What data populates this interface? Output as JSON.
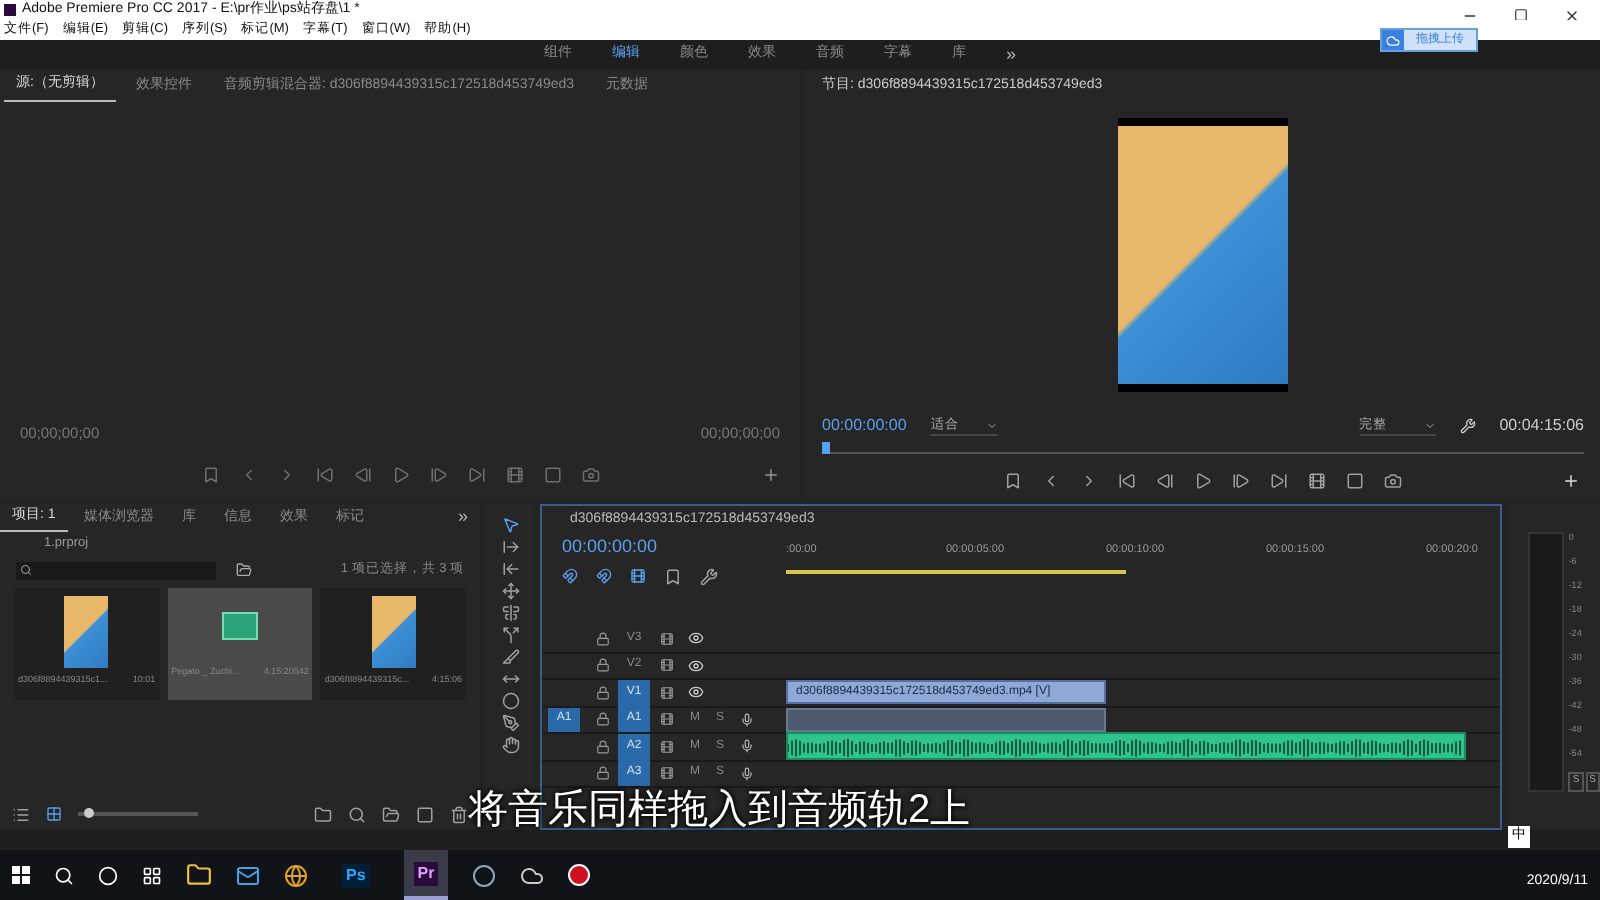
{
  "window": {
    "title": "Adobe Premiere Pro CC 2017 - E:\\pr作业\\ps站存盘\\1 *"
  },
  "menu": [
    "文件(F)",
    "编辑(E)",
    "剪辑(C)",
    "序列(S)",
    "标记(M)",
    "字幕(T)",
    "窗口(W)",
    "帮助(H)"
  ],
  "workspaces": [
    {
      "label": "组件",
      "selected": false
    },
    {
      "label": "编辑",
      "selected": true
    },
    {
      "label": "颜色",
      "selected": false
    },
    {
      "label": "效果",
      "selected": false
    },
    {
      "label": "音频",
      "selected": false
    },
    {
      "label": "字幕",
      "selected": false
    },
    {
      "label": "库",
      "selected": false
    }
  ],
  "workspace_overflow": "»",
  "upload_popup": {
    "label": "拖拽上传"
  },
  "source_panel": {
    "tabs": [
      {
        "label": "源:（无剪辑）",
        "selected": true
      },
      {
        "label": "效果控件",
        "selected": false
      },
      {
        "label": "音频剪辑混合器: d306f8894439315c172518d453749ed3",
        "selected": false
      },
      {
        "label": "元数据",
        "selected": false
      }
    ],
    "timecode_left": "00;00;00;00",
    "timecode_right": "00;00;00;00"
  },
  "program_panel": {
    "title": "节目: d306f8894439315c172518d453749ed3",
    "timecode": "00:00:00:00",
    "zoom": "适合",
    "quality": "完整",
    "duration": "00:04:15:06"
  },
  "project_panel": {
    "tabs": [
      {
        "label": "项目: 1",
        "selected": true
      },
      {
        "label": "媒体浏览器",
        "selected": false
      },
      {
        "label": "库",
        "selected": false
      },
      {
        "label": "信息",
        "selected": false
      },
      {
        "label": "效果",
        "selected": false
      },
      {
        "label": "标记",
        "selected": false
      }
    ],
    "overflow": "»",
    "project_file": "1.prproj",
    "zoom_slider": {
      "level": 0.05
    },
    "selection_info": "1 项已选择，共 3 项",
    "items": [
      {
        "name": "d306f8894439315c1...",
        "duration": "10:01",
        "kind": "video",
        "selected": false
      },
      {
        "name": "Pegato _ Zuchi...",
        "duration": "4:15:20542",
        "kind": "audio",
        "selected": true
      },
      {
        "name": "d306f8894439315c...",
        "duration": "4:15:06",
        "kind": "video",
        "selected": false
      }
    ]
  },
  "timeline": {
    "title": "d306f8894439315c172518d453749ed3",
    "timecode": "00:00:00:00",
    "ruler": [
      ":00:00",
      "00:00:05:00",
      "00:00:10:00",
      "00:00:15:00",
      "00:00:20:0"
    ],
    "tracks": [
      {
        "name": "V3",
        "kind": "video",
        "targeted": false
      },
      {
        "name": "V2",
        "kind": "video",
        "targeted": false
      },
      {
        "name": "V1",
        "kind": "video",
        "targeted": true,
        "clip": {
          "kind": "video",
          "label": "d306f8894439315c172518d453749ed3.mp4 [V]"
        }
      },
      {
        "name": "A1",
        "kind": "audio",
        "targeted": true,
        "source": "A1",
        "mute": "M",
        "solo": "S",
        "clip": {
          "kind": "linked-audio"
        }
      },
      {
        "name": "A2",
        "kind": "audio",
        "targeted": true,
        "mute": "M",
        "solo": "S",
        "clip": {
          "kind": "music"
        }
      },
      {
        "name": "A3",
        "kind": "audio",
        "targeted": true,
        "mute": "M",
        "solo": "S"
      }
    ]
  },
  "meter": {
    "scale": [
      "0",
      "-6",
      "-12",
      "-18",
      "-24",
      "-30",
      "-36",
      "-42",
      "-48",
      "-54"
    ],
    "solo": [
      "S",
      "S"
    ]
  },
  "caption": "将音乐同样拖入到音频轨2上",
  "ime": "中",
  "taskbar": {
    "apps": [
      {
        "kind": "photoshop",
        "label": "Ps",
        "selected": false
      },
      {
        "kind": "premiere",
        "label": "Pr",
        "selected": true
      }
    ],
    "date": "2020/9/11"
  }
}
